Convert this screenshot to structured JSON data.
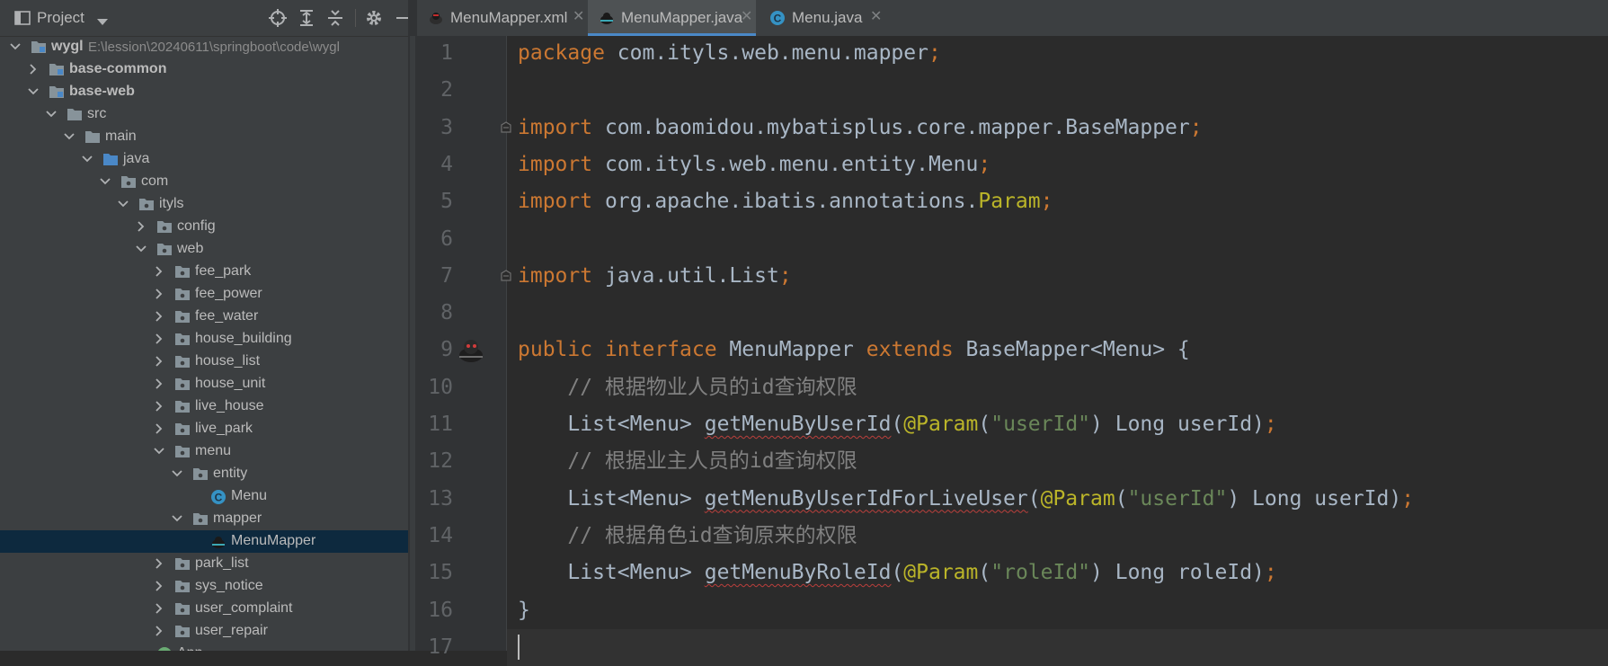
{
  "panel": {
    "title": "Project",
    "dropdown_icon": "chevron-down-icon",
    "toolbar_icons": [
      "locate-icon",
      "expand-all-icon",
      "collapse-all-icon",
      "gear-icon",
      "hide-icon"
    ]
  },
  "tree": {
    "root": {
      "label": "wygl",
      "path": "E:\\lession\\20240611\\springboot\\code\\wygl"
    },
    "items": [
      {
        "label": "base-common"
      },
      {
        "label": "base-web"
      },
      {
        "label": "src"
      },
      {
        "label": "main"
      },
      {
        "label": "java"
      },
      {
        "label": "com"
      },
      {
        "label": "ityls"
      },
      {
        "label": "config"
      },
      {
        "label": "web"
      },
      {
        "label": "fee_park"
      },
      {
        "label": "fee_power"
      },
      {
        "label": "fee_water"
      },
      {
        "label": "house_building"
      },
      {
        "label": "house_list"
      },
      {
        "label": "house_unit"
      },
      {
        "label": "live_house"
      },
      {
        "label": "live_park"
      },
      {
        "label": "menu"
      },
      {
        "label": "entity"
      },
      {
        "label": "Menu"
      },
      {
        "label": "mapper"
      },
      {
        "label": "MenuMapper"
      },
      {
        "label": "park_list"
      },
      {
        "label": "sys_notice"
      },
      {
        "label": "user_complaint"
      },
      {
        "label": "user_repair"
      },
      {
        "label": "App"
      }
    ]
  },
  "tabs": [
    {
      "label": "MenuMapper.xml",
      "active": false
    },
    {
      "label": "MenuMapper.java",
      "active": true
    },
    {
      "label": "Menu.java",
      "active": false
    }
  ],
  "editor": {
    "line_numbers": [
      "1",
      "2",
      "3",
      "4",
      "5",
      "6",
      "7",
      "8",
      "9",
      "10",
      "11",
      "12",
      "13",
      "14",
      "15",
      "16",
      "17"
    ],
    "lines": [
      [
        {
          "t": "package ",
          "c": "kw"
        },
        {
          "t": "com.ityls.web.menu.mapper",
          "c": ""
        },
        {
          "t": ";",
          "c": "semi"
        }
      ],
      [],
      [
        {
          "t": "import ",
          "c": "kw"
        },
        {
          "t": "com.baomidou.mybatisplus.core.mapper.BaseMapper",
          "c": ""
        },
        {
          "t": ";",
          "c": "semi"
        }
      ],
      [
        {
          "t": "import ",
          "c": "kw"
        },
        {
          "t": "com.ityls.web.menu.entity.Menu",
          "c": ""
        },
        {
          "t": ";",
          "c": "semi"
        }
      ],
      [
        {
          "t": "import ",
          "c": "kw"
        },
        {
          "t": "org.apache.ibatis.annotations.",
          "c": ""
        },
        {
          "t": "Param",
          "c": "ann"
        },
        {
          "t": ";",
          "c": "semi"
        }
      ],
      [],
      [
        {
          "t": "import ",
          "c": "kw"
        },
        {
          "t": "java.util.List",
          "c": ""
        },
        {
          "t": ";",
          "c": "semi"
        }
      ],
      [],
      [
        {
          "t": "public ",
          "c": "kw"
        },
        {
          "t": "interface ",
          "c": "kw"
        },
        {
          "t": "MenuMapper ",
          "c": "cls"
        },
        {
          "t": "extends ",
          "c": "kw"
        },
        {
          "t": "BaseMapper<Menu> {",
          "c": ""
        }
      ],
      [
        {
          "t": "    // 根据物业人员的id查询权限",
          "c": "cmt"
        }
      ],
      [
        {
          "t": "    List<Menu> ",
          "c": ""
        },
        {
          "t": "getMenuByUserId",
          "c": "meth"
        },
        {
          "t": "(",
          "c": ""
        },
        {
          "t": "@Param",
          "c": "ann"
        },
        {
          "t": "(",
          "c": ""
        },
        {
          "t": "\"userId\"",
          "c": "str"
        },
        {
          "t": ") Long userId)",
          "c": ""
        },
        {
          "t": ";",
          "c": "semi"
        }
      ],
      [
        {
          "t": "    // 根据业主人员的id查询权限",
          "c": "cmt"
        }
      ],
      [
        {
          "t": "    List<Menu> ",
          "c": ""
        },
        {
          "t": "getMenuByUserIdForLiveUser",
          "c": "meth"
        },
        {
          "t": "(",
          "c": ""
        },
        {
          "t": "@Param",
          "c": "ann"
        },
        {
          "t": "(",
          "c": ""
        },
        {
          "t": "\"userId\"",
          "c": "str"
        },
        {
          "t": ") Long userId)",
          "c": ""
        },
        {
          "t": ";",
          "c": "semi"
        }
      ],
      [
        {
          "t": "    // 根据角色id查询原来的权限",
          "c": "cmt"
        }
      ],
      [
        {
          "t": "    List<Menu> ",
          "c": ""
        },
        {
          "t": "getMenuByRoleId",
          "c": "meth"
        },
        {
          "t": "(",
          "c": ""
        },
        {
          "t": "@Param",
          "c": "ann"
        },
        {
          "t": "(",
          "c": ""
        },
        {
          "t": "\"roleId\"",
          "c": "str"
        },
        {
          "t": ") Long roleId)",
          "c": ""
        },
        {
          "t": ";",
          "c": "semi"
        }
      ],
      [
        {
          "t": "}",
          "c": ""
        }
      ],
      []
    ],
    "current_line": 17
  },
  "colors": {
    "keyword": "#cc7832",
    "annotation": "#bbb529",
    "string": "#6a8759",
    "comment": "#808080",
    "selection": "#0d293e",
    "active_tab_underline": "#4a88c7"
  }
}
